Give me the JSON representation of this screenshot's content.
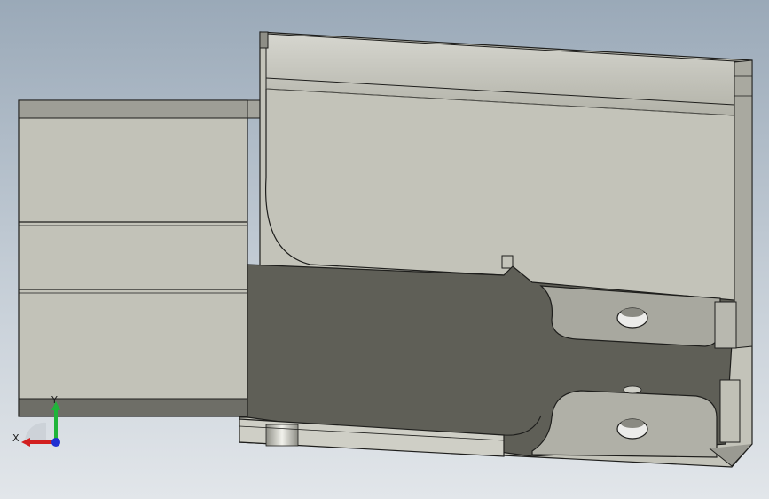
{
  "viewport": {
    "background_top": "#9aa9b8",
    "background_bottom": "#e2e6ea"
  },
  "model": {
    "light_face_color": "#c3c3b9",
    "dark_face_color": "#5f5f57",
    "edge_color": "#1e1e1c"
  },
  "triad": {
    "x_label": "X",
    "y_label": "Y",
    "x_color": "#d21f1f",
    "y_color": "#1fb43a",
    "z_color": "#1f2fd2"
  }
}
